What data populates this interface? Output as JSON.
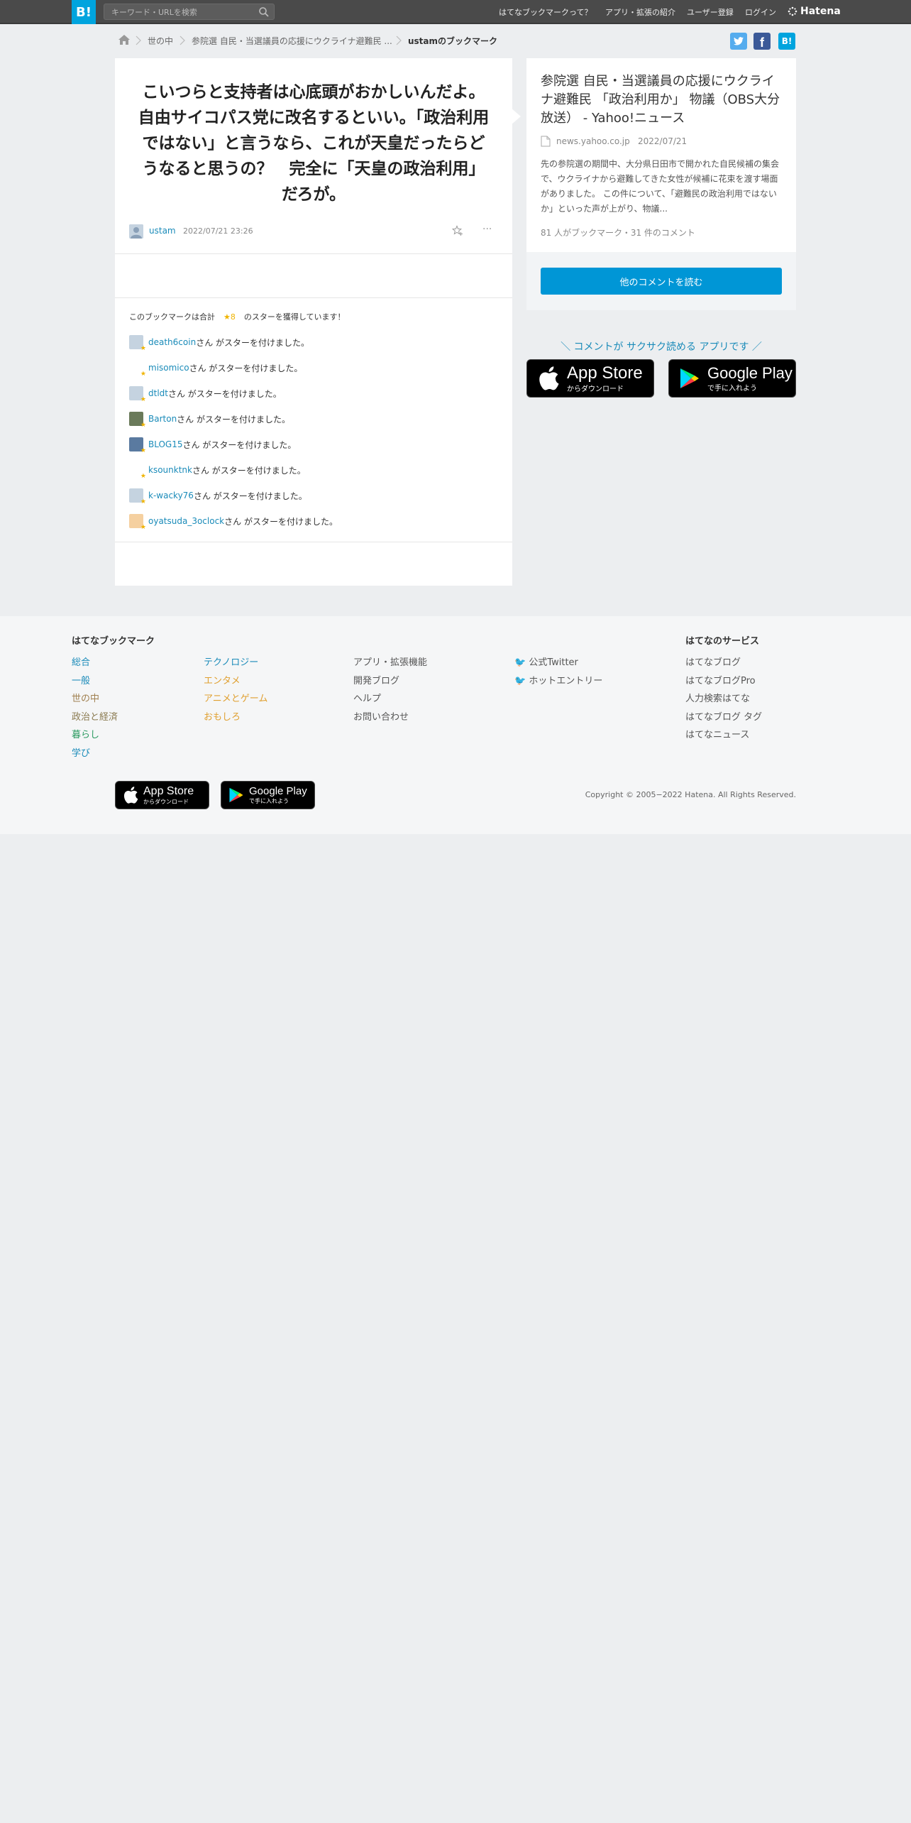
{
  "topbar": {
    "logo": "B!",
    "search_placeholder": "キーワード・URLを検索",
    "nav": [
      "はてなブックマークって？",
      "アプリ・拡張の紹介",
      "ユーザー登録",
      "ログイン"
    ],
    "brand": "Hatena"
  },
  "breadcrumb": {
    "items": [
      "世の中",
      "参院選 自民・当選議員の応援にウクライナ避難民 ...",
      "ustamのブックマーク"
    ]
  },
  "share": {
    "twitter": "twitter-share",
    "facebook": "facebook-share",
    "hatena": "B!"
  },
  "bookmark": {
    "comment": "こいつらと支持者は心底頭がおかしいんだよ。自由サイコパス党に改名するといい。「政治利用ではない」と言うなら、これが天皇だったらどうなると思うの？　完全に「天皇の政治利用」だろが。",
    "user": "ustam",
    "datetime": "2022/07/21 23:26",
    "more": "···",
    "star_summary_prefix": "このブックマークは合計",
    "star_count": "8",
    "star_summary_suffix": "のスターを獲得しています！",
    "star_suffix": "さん がスターを付けました。",
    "stars": [
      {
        "user": "death6coin"
      },
      {
        "user": "misomico"
      },
      {
        "user": "dtldt"
      },
      {
        "user": "Barton"
      },
      {
        "user": "BLOG15"
      },
      {
        "user": "ksounktnk"
      },
      {
        "user": "k-wacky76"
      },
      {
        "user": "oyatsuda_3oclock"
      }
    ]
  },
  "entry": {
    "title": "参院選 自民・当選議員の応援にウクライナ避難民 「政治利用か」 物議（OBS大分放送） - Yahoo!ニュース",
    "domain": "news.yahoo.co.jp",
    "date": "2022/07/21",
    "summary": "先の参院選の期間中、大分県日田市で開かれた自民候補の集会で、ウクライナから避難してきた女性が候補に花束を渡す場面がありました。 この件について、「避難民の政治利用ではないか」といった声が上がり、物議...",
    "stats": "81 人がブックマーク・31 件のコメント",
    "read_more": "他のコメントを読む"
  },
  "app_promo": {
    "text": "＼ コメントが サクサク読める アプリです ／",
    "appstore_main": "App Store",
    "appstore_sub": "からダウンロード",
    "googleplay_main": "Google Play",
    "googleplay_sub": "で手に入れよう"
  },
  "footer": {
    "heading": "はてなブックマーク",
    "col1": [
      "総合",
      "一般",
      "世の中",
      "政治と経済",
      "暮らし",
      "学び"
    ],
    "col2": [
      "テクノロジー",
      "エンタメ",
      "アニメとゲーム",
      "おもしろ"
    ],
    "col3": [
      "アプリ・拡張機能",
      "開発ブログ",
      "ヘルプ",
      "お問い合わせ"
    ],
    "col4": [
      "公式Twitter",
      "ホットエントリー"
    ],
    "services_heading": "はてなのサービス",
    "services": [
      "はてなブログ",
      "はてなブログPro",
      "人力検索はてな",
      "はてなブログ タグ",
      "はてなニュース"
    ],
    "copyright": "Copyright © 2005−2022 Hatena. All Rights Reserved."
  },
  "colors": {
    "accent": "#00a4de",
    "link": "#1a8bb9",
    "star": "#f0b400",
    "button": "#0096d6"
  }
}
